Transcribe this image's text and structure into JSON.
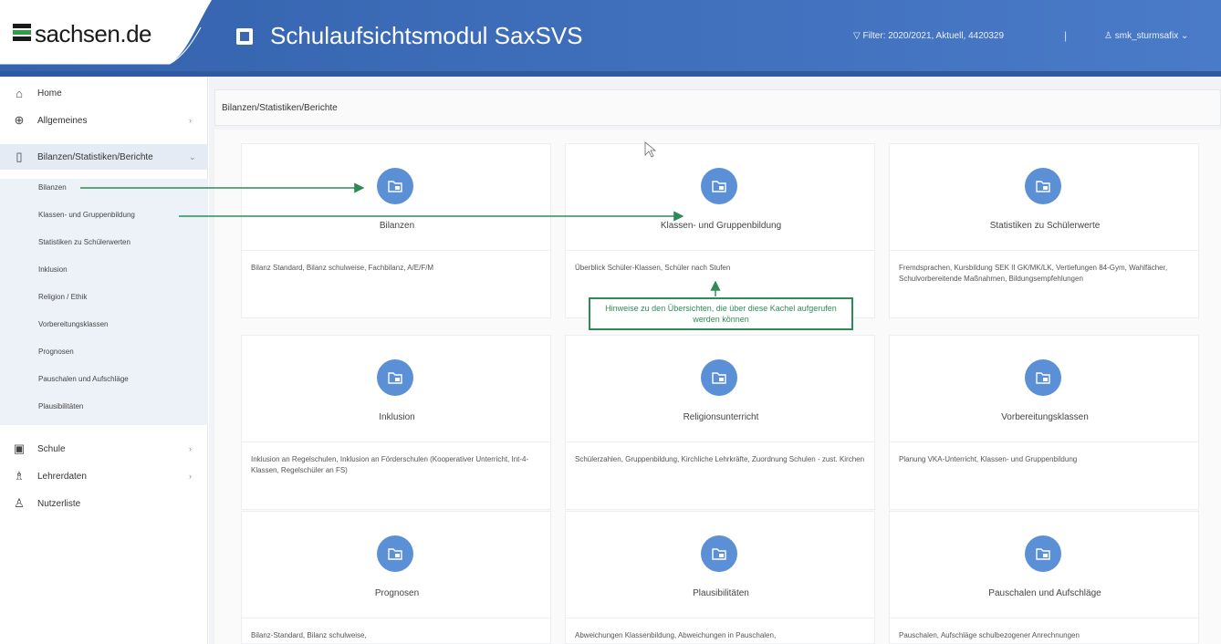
{
  "header": {
    "logo_text": "sachsen.de",
    "app_title": "Schulaufsichtsmodul SaxSVS",
    "filter_text": "Filter: 2020/2021, Aktuell, 4420329",
    "separator": "|",
    "user_text": "smk_sturmsafix"
  },
  "sidebar": {
    "items": [
      {
        "label": "Home",
        "icon": "home-icon"
      },
      {
        "label": "Allgemeines",
        "icon": "globe-icon",
        "chevron": "›"
      },
      {
        "label": "Bilanzen/Statistiken/Berichte",
        "icon": "document-icon",
        "chevron": "⌄"
      },
      {
        "label": "Schule",
        "icon": "building-icon",
        "chevron": "›"
      },
      {
        "label": "Lehrerdaten",
        "icon": "teacher-icon",
        "chevron": "›"
      },
      {
        "label": "Nutzerliste",
        "icon": "users-icon"
      }
    ],
    "subitems": [
      "Bilanzen",
      "Klassen- und Gruppenbildung",
      "Statistiken zu Schülerwerten",
      "Inklusion",
      "Religion / Ethik",
      "Vorbereitungsklassen",
      "Prognosen",
      "Pauschalen und Aufschläge",
      "Plausibilitäten"
    ]
  },
  "main": {
    "breadcrumb": "Bilanzen/Statistiken/Berichte",
    "tiles": [
      {
        "title": "Bilanzen",
        "desc": "Bilanz Standard, Bilanz schulweise, Fachbilanz, A/E/F/M"
      },
      {
        "title": "Klassen- und Gruppenbildung",
        "desc": "Überblick Schüler-Klassen, Schüler nach Stufen"
      },
      {
        "title": "Statistiken zu Schülerwerte",
        "desc": "Fremdsprachen, Kursbildung SEK II GK/MK/LK, Vertiefungen 84-Gym, Wahlfächer, Schulvorbereitende Maßnahmen, Bildungsempfehlungen"
      },
      {
        "title": "Inklusion",
        "desc": "Inklusion an Regelschulen, Inklusion an Förderschulen (Kooperativer Unterricht, Int-4-Klassen, Regelschüler an FS)"
      },
      {
        "title": "Religionsunterricht",
        "desc": "Schülerzahlen, Gruppenbildung, Kirchliche Lehrkräfte, Zuordnung Schulen - zust. Kirchen"
      },
      {
        "title": "Vorbereitungsklassen",
        "desc": "Planung VKA-Unterricht, Klassen- und Gruppenbildung"
      },
      {
        "title": "Prognosen",
        "desc": "Bilanz-Standard, Bilanz schulweise,"
      },
      {
        "title": "Plausibilitäten",
        "desc": "Abweichungen Klassenbildung, Abweichungen in Pauschalen,"
      },
      {
        "title": "Pauschalen und Aufschläge",
        "desc": "Pauschalen, Aufschläge schulbezogener Anrechnungen"
      }
    ]
  },
  "annotation": {
    "text": "Hinweise zu den Übersichten, die über diese Kachel aufgerufen werden können"
  },
  "colors": {
    "header_blue": "#3b67b4",
    "tile_icon_blue": "#5b8fd6",
    "annotation_green": "#2e8b57"
  }
}
